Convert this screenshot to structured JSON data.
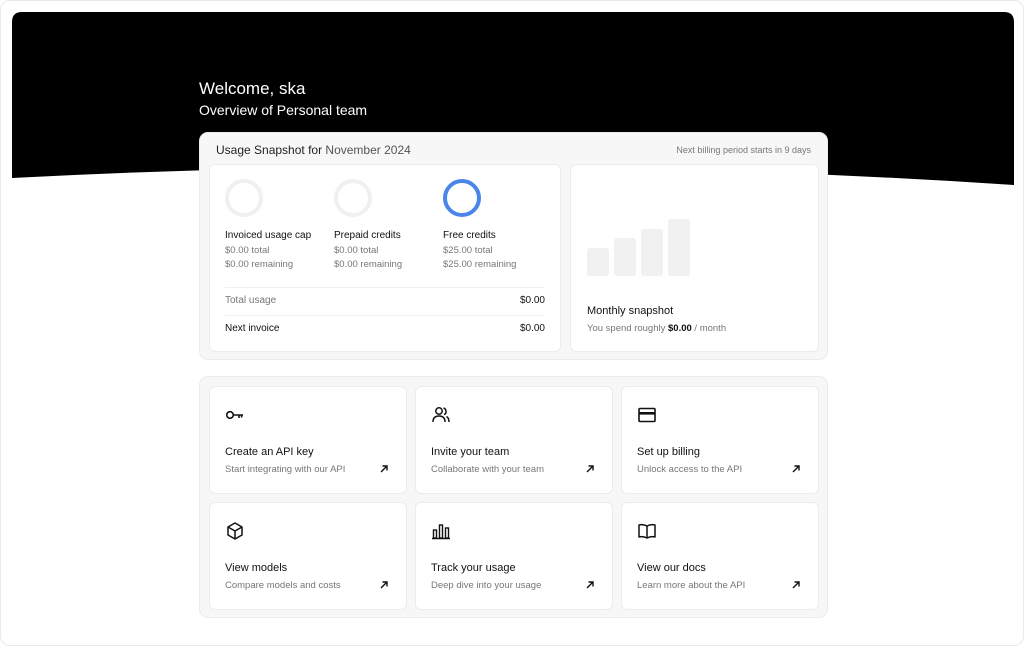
{
  "header": {
    "welcome": "Welcome, ska",
    "overview": "Overview of Personal team"
  },
  "snapshot": {
    "title_prefix": "Usage Snapshot for",
    "month": "November 2024",
    "billing_note": "Next billing period starts in 9 days",
    "gauges": [
      {
        "label": "Invoiced usage cap",
        "total": "$0.00 total",
        "remaining": "$0.00 remaining",
        "active": false
      },
      {
        "label": "Prepaid credits",
        "total": "$0.00 total",
        "remaining": "$0.00 remaining",
        "active": false
      },
      {
        "label": "Free credits",
        "total": "$25.00 total",
        "remaining": "$25.00 remaining",
        "active": true
      }
    ],
    "total_usage_label": "Total usage",
    "total_usage_value": "$0.00",
    "next_invoice_label": "Next invoice",
    "next_invoice_value": "$0.00",
    "monthly": {
      "title": "Monthly snapshot",
      "desc_prefix": "You spend roughly",
      "amount": "$0.00",
      "desc_suffix": "/ month"
    }
  },
  "actions": [
    {
      "title": "Create an API key",
      "desc": "Start integrating with our API",
      "icon": "key-icon"
    },
    {
      "title": "Invite your team",
      "desc": "Collaborate with your team",
      "icon": "users-icon"
    },
    {
      "title": "Set up billing",
      "desc": "Unlock access to the API",
      "icon": "credit-card-icon"
    },
    {
      "title": "View models",
      "desc": "Compare models and costs",
      "icon": "cube-icon"
    },
    {
      "title": "Track your usage",
      "desc": "Deep dive into your usage",
      "icon": "bar-chart-icon"
    },
    {
      "title": "View our docs",
      "desc": "Learn more about the API",
      "icon": "book-icon"
    }
  ],
  "colors": {
    "hero": "#000000",
    "accent": "#4a86e8"
  }
}
